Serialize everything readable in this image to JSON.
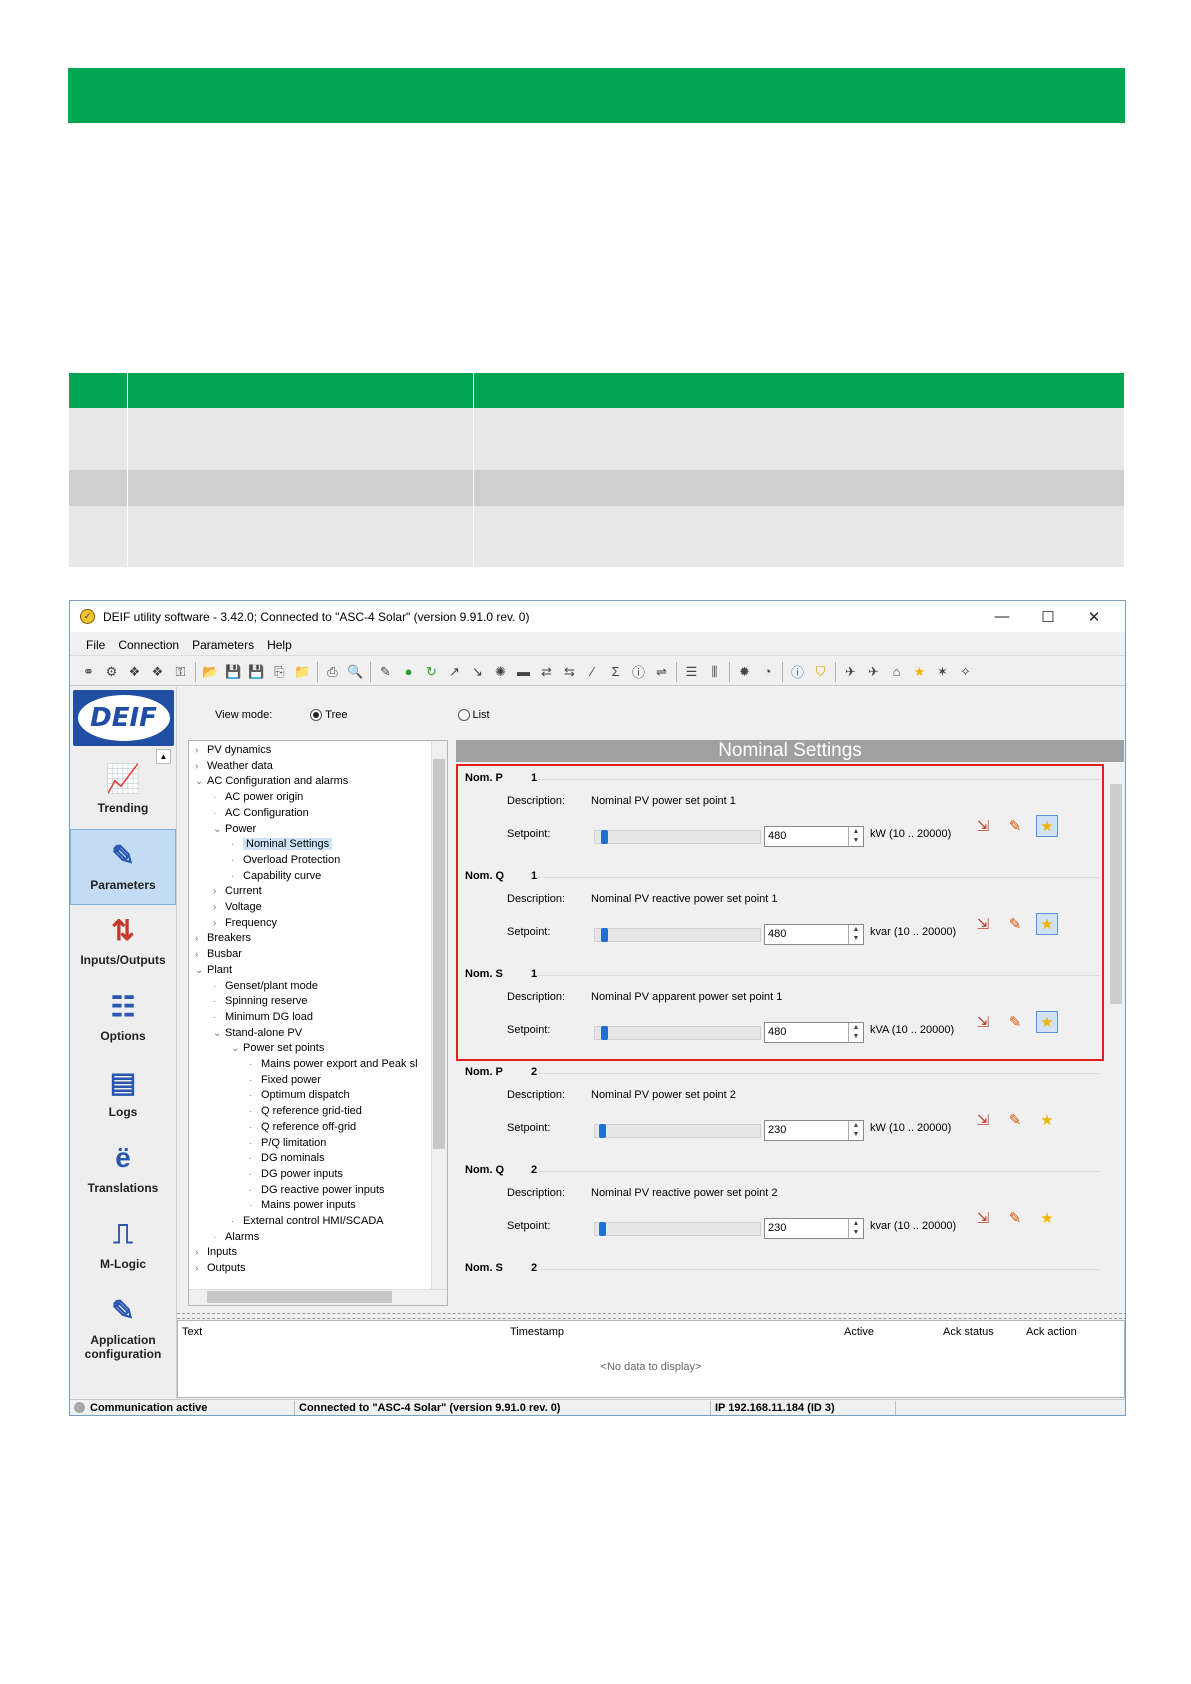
{
  "window": {
    "title": "DEIF utility software - 3.42.0; Connected to \"ASC-4 Solar\" (version 9.91.0 rev. 0)",
    "minimize": "—",
    "maximize": "☐",
    "close": "✕"
  },
  "menu": [
    "File",
    "Connection",
    "Parameters",
    "Help"
  ],
  "sidebar": {
    "logo": "DEIF",
    "items": [
      {
        "label": "Trending",
        "icon": "trending-icon"
      },
      {
        "label": "Parameters",
        "icon": "parameters-icon"
      },
      {
        "label": "Inputs/Outputs",
        "icon": "inputs-outputs-icon"
      },
      {
        "label": "Options",
        "icon": "options-icon"
      },
      {
        "label": "Logs",
        "icon": "logs-icon"
      },
      {
        "label": "Translations",
        "icon": "translations-icon"
      },
      {
        "label": "M-Logic",
        "icon": "m-logic-icon"
      },
      {
        "label": "Application configuration",
        "icon": "application-configuration-icon"
      }
    ]
  },
  "viewmode": {
    "label": "View mode:",
    "tree": "Tree",
    "list": "List",
    "selected": "Tree"
  },
  "tree": [
    {
      "label": "PV dynamics",
      "arrow": ">"
    },
    {
      "label": "Weather data",
      "arrow": ">"
    },
    {
      "label": "AC Configuration and alarms",
      "arrow": "v"
    },
    {
      "label": "AC power origin",
      "arrow": ""
    },
    {
      "label": "AC Configuration",
      "arrow": ""
    },
    {
      "label": "Power",
      "arrow": "v"
    },
    {
      "label": "Nominal Settings",
      "arrow": ""
    },
    {
      "label": "Overload Protection",
      "arrow": ""
    },
    {
      "label": "Capability curve",
      "arrow": ""
    },
    {
      "label": "Current",
      "arrow": ">"
    },
    {
      "label": "Voltage",
      "arrow": ">"
    },
    {
      "label": "Frequency",
      "arrow": ">"
    },
    {
      "label": "Breakers",
      "arrow": ">"
    },
    {
      "label": "Busbar",
      "arrow": ">"
    },
    {
      "label": "Plant",
      "arrow": "v"
    },
    {
      "label": "Genset/plant mode",
      "arrow": ""
    },
    {
      "label": "Spinning reserve",
      "arrow": ""
    },
    {
      "label": "Minimum DG load",
      "arrow": ""
    },
    {
      "label": "Stand-alone PV",
      "arrow": "v"
    },
    {
      "label": "Power set points",
      "arrow": "v"
    },
    {
      "label": "Mains power export and Peak sl",
      "arrow": ""
    },
    {
      "label": "Fixed power",
      "arrow": ""
    },
    {
      "label": "Optimum dispatch",
      "arrow": ""
    },
    {
      "label": "Q reference grid-tied",
      "arrow": ""
    },
    {
      "label": "Q reference off-grid",
      "arrow": ""
    },
    {
      "label": "P/Q limitation",
      "arrow": ""
    },
    {
      "label": "DG nominals",
      "arrow": ""
    },
    {
      "label": "DG power inputs",
      "arrow": ""
    },
    {
      "label": "DG reactive power inputs",
      "arrow": ""
    },
    {
      "label": "Mains power inputs",
      "arrow": ""
    },
    {
      "label": "External control HMI/SCADA",
      "arrow": ""
    },
    {
      "label": "Alarms",
      "arrow": ""
    },
    {
      "label": "Inputs",
      "arrow": ">"
    },
    {
      "label": "Outputs",
      "arrow": ">"
    }
  ],
  "panel": {
    "title": "Nominal Settings",
    "desc_label": "Description:",
    "setpoint_label": "Setpoint:",
    "groups": [
      {
        "name": "Nom. P",
        "num": "1",
        "description": "Nominal PV power set point 1",
        "value": "480",
        "unit": "kW (10 .. 20000)",
        "level": 0.024
      },
      {
        "name": "Nom. Q",
        "num": "1",
        "description": "Nominal PV reactive power set point 1",
        "value": "480",
        "unit": "kvar (10 .. 20000)",
        "level": 0.024
      },
      {
        "name": "Nom. S",
        "num": "1",
        "description": "Nominal PV apparent power set point 1",
        "value": "480",
        "unit": "kVA (10 .. 20000)",
        "level": 0.024
      },
      {
        "name": "Nom. P",
        "num": "2",
        "description": "Nominal PV power set point 2",
        "value": "230",
        "unit": "kW (10 .. 20000)",
        "level": 0.011
      },
      {
        "name": "Nom. Q",
        "num": "2",
        "description": "Nominal PV reactive power set point 2",
        "value": "230",
        "unit": "kvar (10 .. 20000)",
        "level": 0.011
      },
      {
        "name": "Nom. S",
        "num": "2",
        "description": "",
        "value": "",
        "unit": "",
        "level": 0
      }
    ]
  },
  "log": {
    "columns": [
      "Text",
      "Timestamp",
      "Active",
      "Ack status",
      "Ack action"
    ],
    "empty": "<No data to display>"
  },
  "status": {
    "comm": "Communication active",
    "connected": "Connected to \"ASC-4 Solar\" (version 9.91.0 rev. 0)",
    "ip": "IP 192.168.11.184 (ID 3)"
  },
  "colors": {
    "brand_green": "#00a651",
    "deif_blue": "#1f4ea3",
    "highlight_red": "#e0201e"
  }
}
